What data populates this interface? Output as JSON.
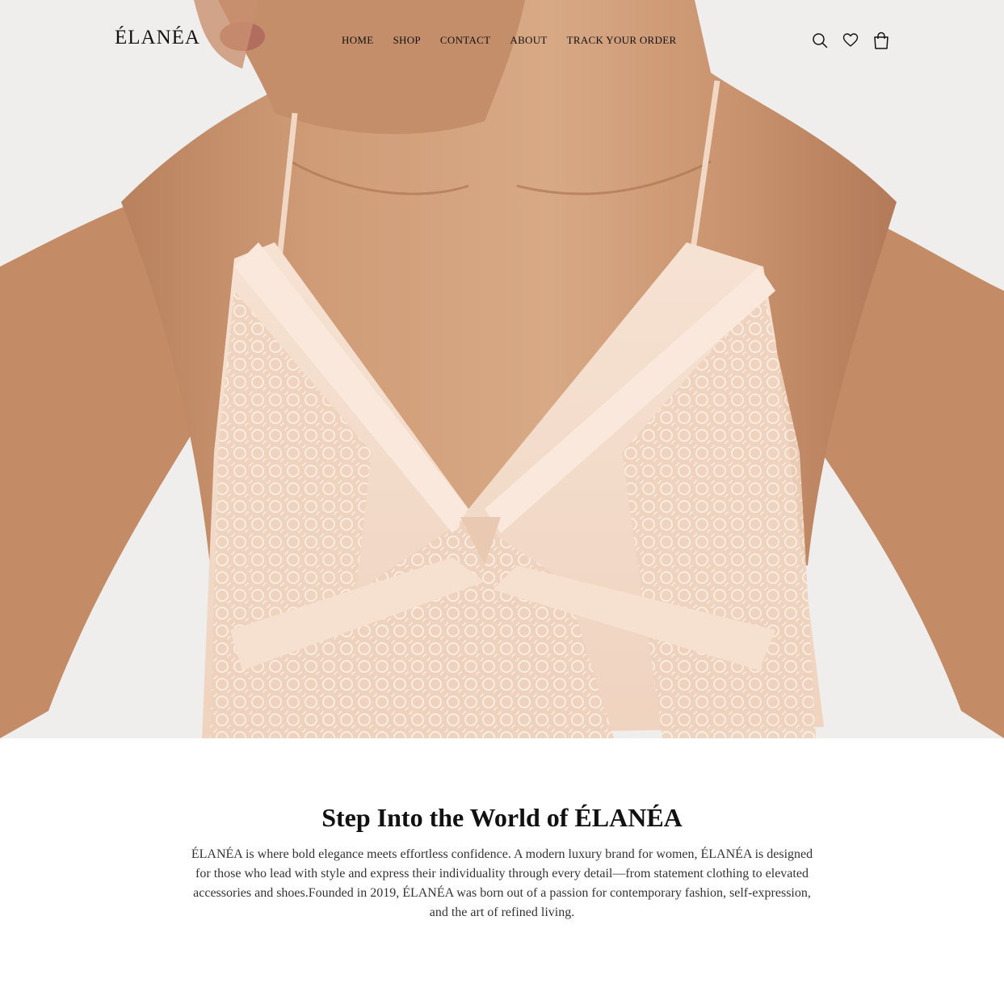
{
  "brand": {
    "logo": "ÉLANÉA"
  },
  "nav": {
    "items": [
      {
        "label": "HOME"
      },
      {
        "label": "SHOP"
      },
      {
        "label": "CONTACT"
      },
      {
        "label": "ABOUT"
      },
      {
        "label": "TRACK YOUR ORDER"
      }
    ]
  },
  "header_icons": {
    "search": "search-icon",
    "wishlist": "heart-icon",
    "cart": "shopping-bag-icon"
  },
  "hero": {
    "image_subject": "model-in-blush-lace-slip-dress"
  },
  "intro": {
    "title": "Step Into the World of ÉLANÉA",
    "body": "ÉLANÉA is where bold elegance meets effortless confidence. A modern luxury brand for women, ÉLANÉA is designed for those who lead with style and express their individuality through every detail—from statement clothing to elevated accessories and shoes.Founded in 2019, ÉLANÉA was born out of a passion for contemporary fashion, self-expression, and the art of refined living."
  },
  "colors": {
    "text": "#111111",
    "body_text": "#333333",
    "background": "#ffffff",
    "dress": "#f3d9c6",
    "skin": "#c9946f"
  }
}
